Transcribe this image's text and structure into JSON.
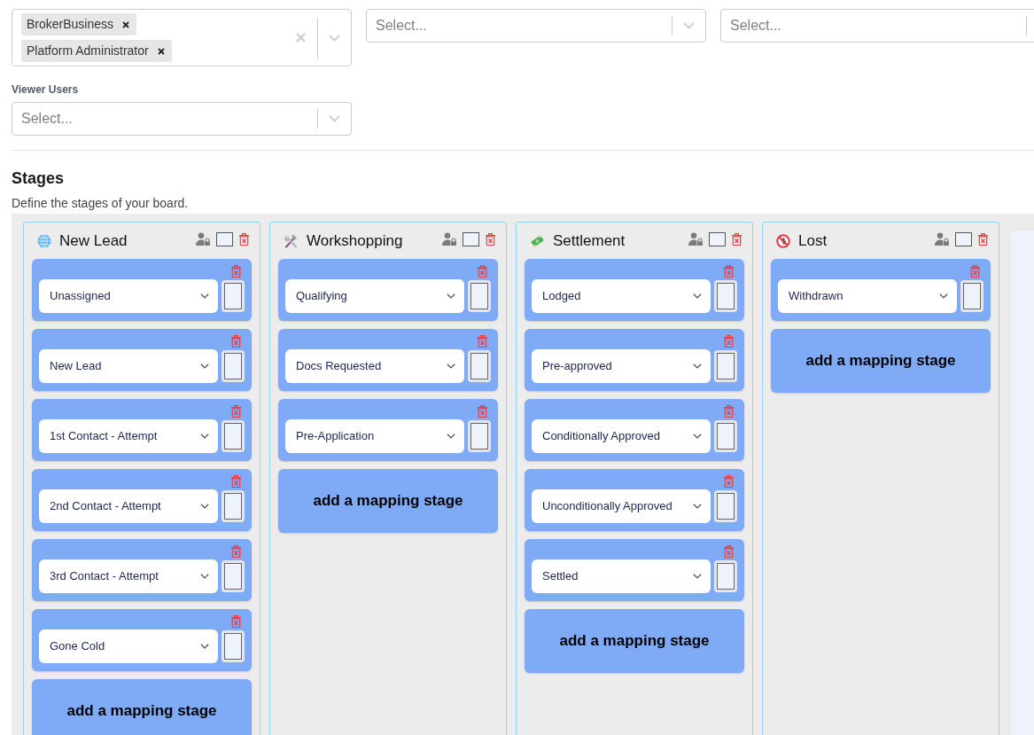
{
  "filters": [
    {
      "kind": "multi",
      "values": [
        "BrokerBusiness",
        "Platform Administrator"
      ]
    },
    {
      "kind": "single",
      "placeholder": "Select..."
    },
    {
      "kind": "single",
      "placeholder": "Select..."
    }
  ],
  "viewer_users": {
    "label": "Viewer Users",
    "placeholder": "Select..."
  },
  "stages": {
    "title": "Stages",
    "description": "Define the stages of your board.",
    "columns": [
      {
        "kind": "globe",
        "title": "New Lead",
        "mappings": [
          "Unassigned",
          "New Lead",
          "1st Contact - Attempt",
          "2nd Contact - Attempt",
          "3rd Contact - Attempt",
          "Gone Cold"
        ],
        "add_label": "add a mapping stage"
      },
      {
        "kind": "tools",
        "title": "Workshopping",
        "mappings": [
          "Qualifying",
          "Docs Requested",
          "Pre-Application"
        ],
        "add_label": "add a mapping stage"
      },
      {
        "kind": "money",
        "title": "Settlement",
        "mappings": [
          "Lodged",
          "Pre-approved",
          "Conditionally Approved",
          "Unconditionally Approved",
          "Settled"
        ],
        "add_label": "add a mapping stage"
      },
      {
        "kind": "prohibited",
        "title": "Lost",
        "mappings": [
          "Withdrawn"
        ],
        "add_label": "add a mapping stage"
      }
    ]
  }
}
